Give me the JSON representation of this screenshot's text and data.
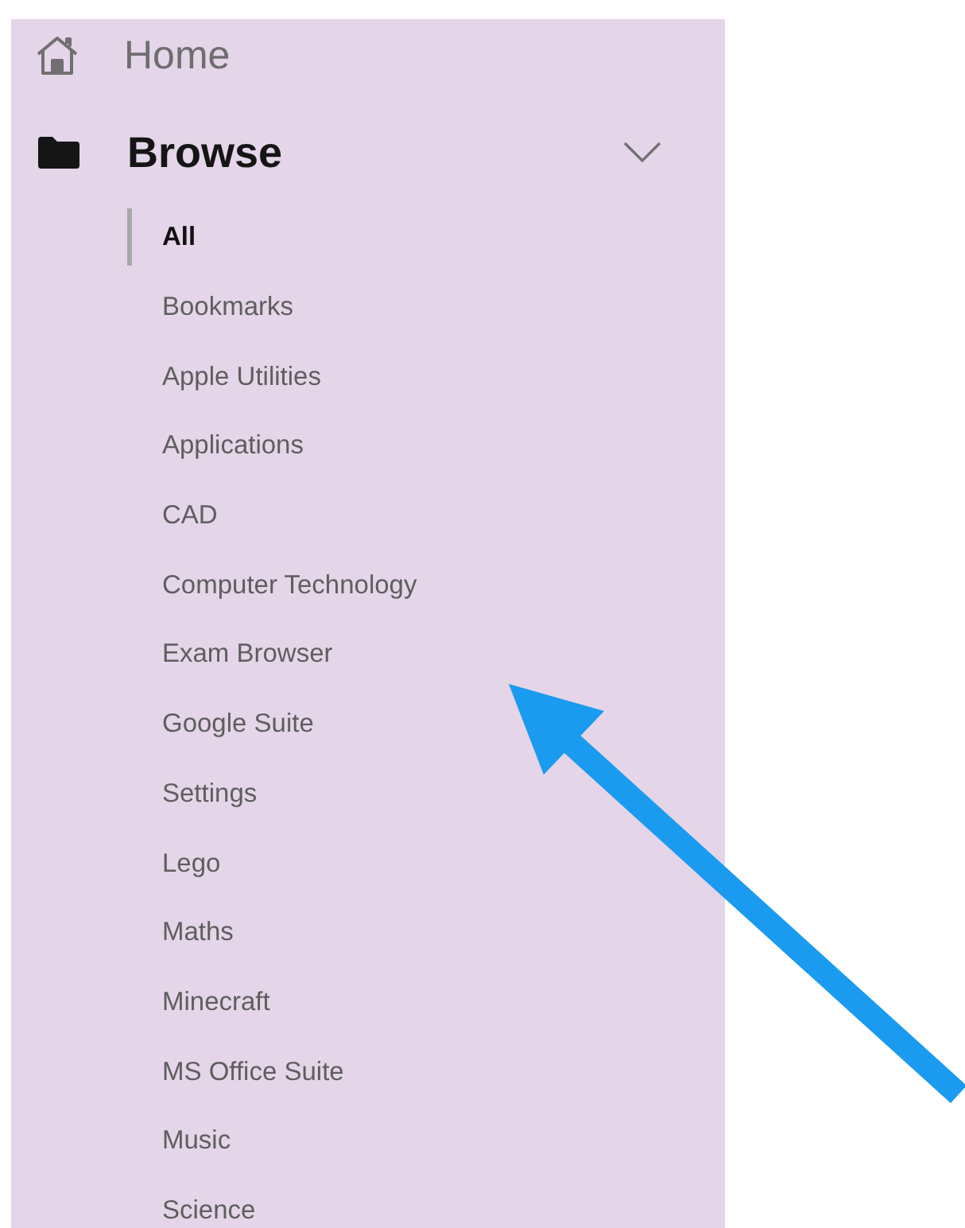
{
  "sidebar": {
    "items": [
      {
        "label": "Home",
        "kind": "home"
      },
      {
        "label": "Browse",
        "kind": "folder",
        "expanded": true,
        "children": [
          {
            "label": "All",
            "selected": true
          },
          {
            "label": "Bookmarks",
            "selected": false
          },
          {
            "label": "Apple Utilities",
            "selected": false
          },
          {
            "label": "Applications",
            "selected": false
          },
          {
            "label": "CAD",
            "selected": false
          },
          {
            "label": "Computer Technology",
            "selected": false
          },
          {
            "label": "Exam Browser",
            "selected": false
          },
          {
            "label": "Google Suite",
            "selected": false
          },
          {
            "label": "Settings",
            "selected": false
          },
          {
            "label": "Lego",
            "selected": false
          },
          {
            "label": "Maths",
            "selected": false
          },
          {
            "label": "Minecraft",
            "selected": false
          },
          {
            "label": "MS Office Suite",
            "selected": false
          },
          {
            "label": "Music",
            "selected": false
          },
          {
            "label": "Science",
            "selected": false
          }
        ]
      }
    ]
  }
}
